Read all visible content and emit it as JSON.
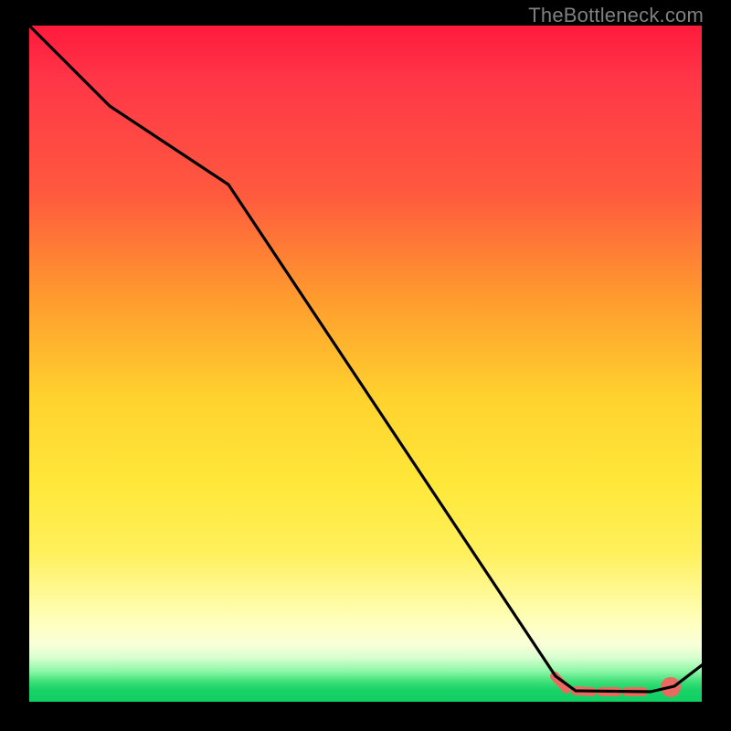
{
  "watermark": "TheBottleneck.com",
  "chart_data": {
    "type": "line",
    "title": "",
    "xlabel": "",
    "ylabel": "",
    "xlim": [
      0,
      100
    ],
    "ylim": [
      0,
      100
    ],
    "grid": false,
    "series": [
      {
        "name": "bottleneck-curve",
        "x": [
          0,
          12,
          30,
          78,
          81,
          92,
          96,
          100
        ],
        "values": [
          100,
          88,
          76,
          2,
          1,
          1,
          1.5,
          5
        ]
      }
    ],
    "markers": [
      {
        "name": "min-region-start",
        "x": 78,
        "y": 2,
        "style": "dot-red"
      },
      {
        "name": "min-region-mid1",
        "x": 82,
        "y": 1.2,
        "style": "dot-red"
      },
      {
        "name": "min-region-mid2",
        "x": 86,
        "y": 1.0,
        "style": "dot-red"
      },
      {
        "name": "min-region-mid3",
        "x": 90,
        "y": 1.0,
        "style": "dot-red"
      },
      {
        "name": "min-region-end",
        "x": 95.5,
        "y": 1.5,
        "style": "dot-red"
      }
    ]
  },
  "colors": {
    "curve": "#000000",
    "marker": "#ea6a62",
    "background_top": "#ff1a3c",
    "background_bottom": "#0fcf63"
  }
}
